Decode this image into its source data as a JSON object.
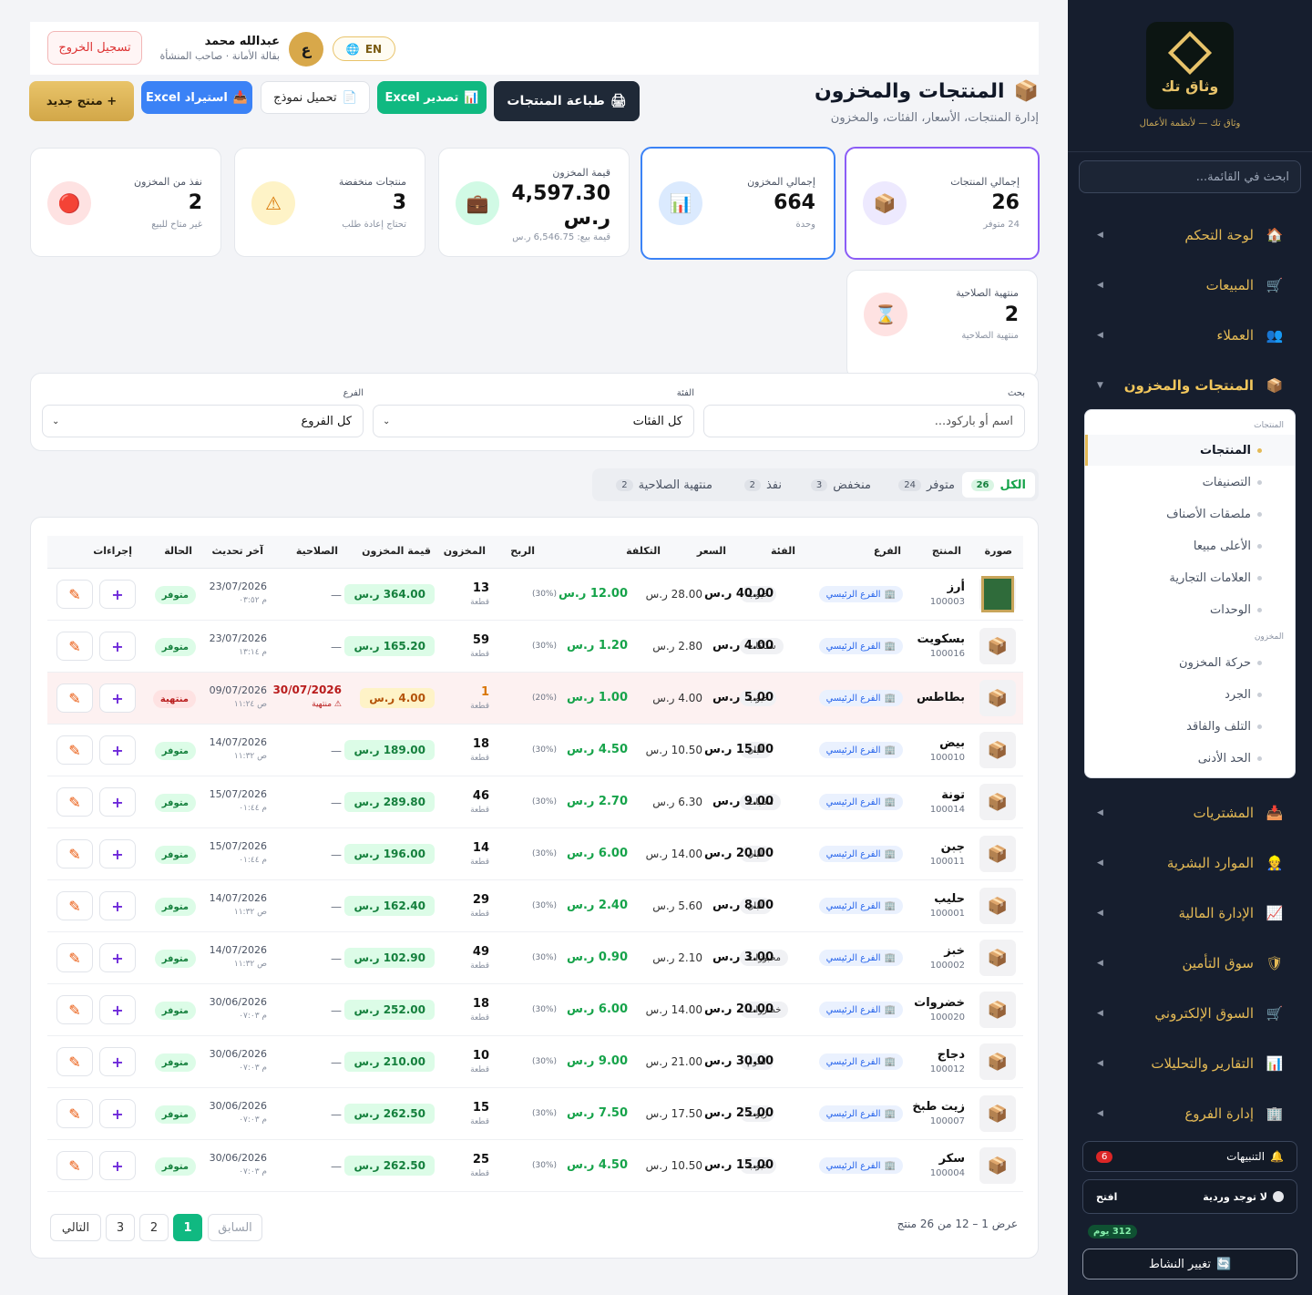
{
  "sidebar": {
    "logo_text": "وثاق تك",
    "brand_sub": "وثاق تك — لأنظمة الأعمال",
    "search_placeholder": "ابحث في القائمة...",
    "items": [
      {
        "label": "لوحة التحكم",
        "icon": "🏠"
      },
      {
        "label": "المبيعات",
        "icon": "🛒"
      },
      {
        "label": "العملاء",
        "icon": "👥"
      },
      {
        "label": "المنتجات والمخزون",
        "icon": "📦"
      },
      {
        "label": "المشتريات",
        "icon": "📥"
      },
      {
        "label": "الموارد البشرية",
        "icon": "👷"
      },
      {
        "label": "الإدارة المالية",
        "icon": "📈"
      },
      {
        "label": "سوق التأمين",
        "icon": "🛡"
      },
      {
        "label": "السوق الإلكتروني",
        "icon": "🛒"
      },
      {
        "label": "التقارير والتحليلات",
        "icon": "📊"
      },
      {
        "label": "إدارة الفروع",
        "icon": "🏢"
      }
    ],
    "submenu": {
      "group1": "المنتجات",
      "group1_items": [
        "المنتجات",
        "التصنيفات",
        "ملصقات الأصناف",
        "الأعلى مبيعا",
        "العلامات التجارية",
        "الوحدات"
      ],
      "group2": "المخزون",
      "group2_items": [
        "حركة المخزون",
        "الجرد",
        "التلف والفاقد",
        "الحد الأدنى"
      ]
    },
    "alerts_label": "التنبيهات",
    "alerts_count": "6",
    "shift_label": "لا توجد وردية",
    "shift_action": "افتح",
    "days_badge": "312 يوم",
    "switch_label": "تغيير النشاط"
  },
  "topbar": {
    "logout": "تسجيل الخروج",
    "user_name": "عبدالله محمد",
    "user_sub": "بقالة الأمانة · صاحب المنشأة",
    "avatar_letter": "ع",
    "lang": "EN"
  },
  "toolbar": {
    "new_product": "+ منتج جديد",
    "import_excel": "استيراد Excel",
    "download_template": "تحميل نموذج",
    "export_excel": "تصدير Excel",
    "print_products": "طباعة المنتجات"
  },
  "page": {
    "title": "المنتجات والمخزون",
    "subtitle": "إدارة المنتجات، الأسعار، الفئات، والمخزون"
  },
  "stats": [
    {
      "title": "إجمالي المنتجات",
      "value": "26",
      "sub": "24 متوفر",
      "icon": "📦"
    },
    {
      "title": "إجمالي المخزون",
      "value": "664",
      "sub": "وحدة",
      "icon": "📊"
    },
    {
      "title": "قيمة المخزون",
      "value": "4,597.30 ر.س",
      "sub": "قيمة بيع: 6,546.75 ر.س",
      "icon": "💼"
    },
    {
      "title": "منتجات منخفضة",
      "value": "3",
      "sub": "تحتاج إعادة طلب",
      "icon": "⚠"
    },
    {
      "title": "نفذ من المخزون",
      "value": "2",
      "sub": "غير متاح للبيع",
      "icon": "🔴"
    },
    {
      "title": "منتهية الصلاحية",
      "value": "2",
      "sub": "منتهية الصلاحية",
      "icon": "⌛"
    }
  ],
  "filters": {
    "search_label": "بحث",
    "search_placeholder": "اسم أو باركود...",
    "category_label": "الفئة",
    "category_value": "كل الفئات",
    "branch_label": "الفرع",
    "branch_value": "كل الفروع"
  },
  "tabs": [
    {
      "label": "الكل",
      "count": "26"
    },
    {
      "label": "متوفر",
      "count": "24"
    },
    {
      "label": "منخفض",
      "count": "3"
    },
    {
      "label": "نفذ",
      "count": "2"
    },
    {
      "label": "منتهية الصلاحية",
      "count": "2"
    }
  ],
  "table": {
    "headers": [
      "صورة",
      "المنتج",
      "الفرع",
      "الفئة",
      "السعر",
      "التكلفة",
      "الربح",
      "المخزون",
      "قيمة المخزون",
      "الصلاحية",
      "آخر تحديث",
      "الحالة",
      "إجراءات"
    ],
    "qty_unit": "قطعة",
    "rows": [
      {
        "name": "أرز",
        "code": "100003",
        "branch": "الفرع الرئيسي",
        "category": "حبوب",
        "price": "40.00 ر.س",
        "cost": "28.00 ر.س",
        "profit": "12.00 ر.س",
        "pct": "(30%)",
        "qty": "13",
        "value": "364.00 ر.س",
        "expiry": "—",
        "updated": "23/07/2026",
        "time": "م ٠٣:٥٢",
        "status": "متوفر"
      },
      {
        "name": "بسكويت",
        "code": "100016",
        "branch": "الفرع الرئيسي",
        "category": "سناكات",
        "price": "4.00 ر.س",
        "cost": "2.80 ر.س",
        "profit": "1.20 ر.س",
        "pct": "(30%)",
        "qty": "59",
        "value": "165.20 ر.س",
        "expiry": "—",
        "updated": "23/07/2026",
        "time": "م ١٣:١٤",
        "status": "متوفر"
      },
      {
        "name": "بطاطس",
        "code": "",
        "branch": "الفرع الرئيسي",
        "category": "حبوب",
        "price": "5.00 ر.س",
        "cost": "4.00 ر.س",
        "profit": "1.00 ر.س",
        "pct": "(20%)",
        "qty": "1",
        "value": "4.00 ر.س",
        "expiry": "30/07/2026",
        "expiry_note": "⚠ منتهية",
        "updated": "09/07/2026",
        "time": "ص ١١:٢٤",
        "status": "منتهية"
      },
      {
        "name": "بيض",
        "code": "100010",
        "branch": "الفرع الرئيسي",
        "category": "ألبان",
        "price": "15.00 ر.س",
        "cost": "10.50 ر.س",
        "profit": "4.50 ر.س",
        "pct": "(30%)",
        "qty": "18",
        "value": "189.00 ر.س",
        "expiry": "—",
        "updated": "14/07/2026",
        "time": "ص ١١:٣٢",
        "status": "متوفر"
      },
      {
        "name": "تونة",
        "code": "100014",
        "branch": "الفرع الرئيسي",
        "category": "معلبات",
        "price": "9.00 ر.س",
        "cost": "6.30 ر.س",
        "profit": "2.70 ر.س",
        "pct": "(30%)",
        "qty": "46",
        "value": "289.80 ر.س",
        "expiry": "—",
        "updated": "15/07/2026",
        "time": "م ٠١:٤٤",
        "status": "متوفر"
      },
      {
        "name": "جبن",
        "code": "100011",
        "branch": "الفرع الرئيسي",
        "category": "ألبان",
        "price": "20.00 ر.س",
        "cost": "14.00 ر.س",
        "profit": "6.00 ر.س",
        "pct": "(30%)",
        "qty": "14",
        "value": "196.00 ر.س",
        "expiry": "—",
        "updated": "15/07/2026",
        "time": "م ٠١:٤٤",
        "status": "متوفر"
      },
      {
        "name": "حليب",
        "code": "100001",
        "branch": "الفرع الرئيسي",
        "category": "ألبان",
        "price": "8.00 ر.س",
        "cost": "5.60 ر.س",
        "profit": "2.40 ر.س",
        "pct": "(30%)",
        "qty": "29",
        "value": "162.40 ر.س",
        "expiry": "—",
        "updated": "14/07/2026",
        "time": "ص ١١:٣٢",
        "status": "متوفر"
      },
      {
        "name": "خبز",
        "code": "100002",
        "branch": "الفرع الرئيسي",
        "category": "مخبوزات",
        "price": "3.00 ر.س",
        "cost": "2.10 ر.س",
        "profit": "0.90 ر.س",
        "pct": "(30%)",
        "qty": "49",
        "value": "102.90 ر.س",
        "expiry": "—",
        "updated": "14/07/2026",
        "time": "ص ١١:٣٢",
        "status": "متوفر"
      },
      {
        "name": "خضروات",
        "code": "100020",
        "branch": "الفرع الرئيسي",
        "category": "خضروات",
        "price": "20.00 ر.س",
        "cost": "14.00 ر.س",
        "profit": "6.00 ر.س",
        "pct": "(30%)",
        "qty": "18",
        "value": "252.00 ر.س",
        "expiry": "—",
        "updated": "30/06/2026",
        "time": "م ٠٧:٠٣",
        "status": "متوفر"
      },
      {
        "name": "دجاج",
        "code": "100012",
        "branch": "الفرع الرئيسي",
        "category": "لحوم",
        "price": "30.00 ر.س",
        "cost": "21.00 ر.س",
        "profit": "9.00 ر.س",
        "pct": "(30%)",
        "qty": "10",
        "value": "210.00 ر.س",
        "expiry": "—",
        "updated": "30/06/2026",
        "time": "م ٠٧:٠٣",
        "status": "متوفر"
      },
      {
        "name": "زيت طبخ",
        "code": "100007",
        "branch": "الفرع الرئيسي",
        "category": "زيوت",
        "price": "25.00 ر.س",
        "cost": "17.50 ر.س",
        "profit": "7.50 ر.س",
        "pct": "(30%)",
        "qty": "15",
        "value": "262.50 ر.س",
        "expiry": "—",
        "updated": "30/06/2026",
        "time": "م ٠٧:٠٣",
        "status": "متوفر"
      },
      {
        "name": "سكر",
        "code": "100004",
        "branch": "الفرع الرئيسي",
        "category": "حبوب",
        "price": "15.00 ر.س",
        "cost": "10.50 ر.س",
        "profit": "4.50 ر.س",
        "pct": "(30%)",
        "qty": "25",
        "value": "262.50 ر.س",
        "expiry": "—",
        "updated": "30/06/2026",
        "time": "م ٠٧:٠٣",
        "status": "متوفر"
      }
    ]
  },
  "pagination": {
    "summary": "عرض 1 – 12 من 26 منتج",
    "prev": "السابق",
    "pages": [
      "1",
      "2",
      "3"
    ],
    "next": "التالي"
  }
}
